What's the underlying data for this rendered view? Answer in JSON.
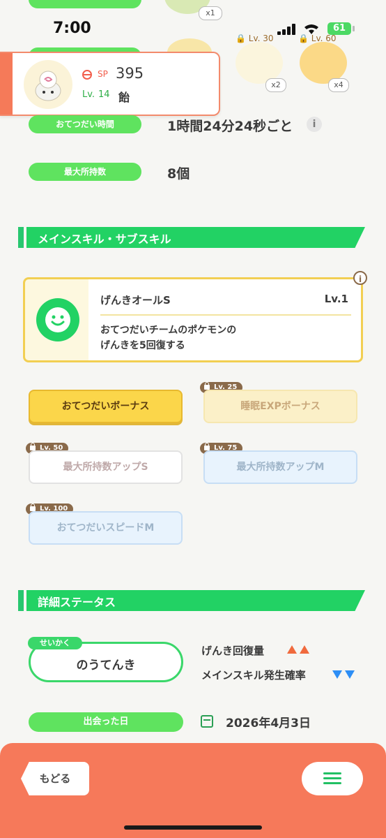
{
  "status_bar": {
    "time": "7:00",
    "battery": "61"
  },
  "top_items": {
    "count_1": "x1",
    "item_lv_30": "Lv. 30",
    "item_lv_60": "Lv. 60",
    "count_2": "x2",
    "count_4": "x4"
  },
  "pokemon": {
    "sp_label": "SP",
    "sp_value": "395",
    "lv_label": "Lv.",
    "lv_value": "14",
    "name": "飴"
  },
  "stats": {
    "help_time_label": "おてつだい時間",
    "help_time_value": "1時間24分24秒ごと",
    "max_carry_label": "最大所持数",
    "max_carry_value": "8個",
    "info_symbol": "i"
  },
  "skills_section": {
    "title": "メインスキル・サブスキル",
    "main_skill": {
      "name": "げんきオールS",
      "level": "Lv.1",
      "description": "おてつだいチームのポケモンの\nげんきを5回復する"
    },
    "sub_skills": [
      {
        "label": "おてつだいボーナス",
        "lock": ""
      },
      {
        "label": "睡眠EXPボーナス",
        "lock": "Lv. 25"
      },
      {
        "label": "最大所持数アップS",
        "lock": "Lv. 50"
      },
      {
        "label": "最大所持数アップM",
        "lock": "Lv. 75"
      },
      {
        "label": "おてつだいスピードM",
        "lock": "Lv. 100"
      }
    ]
  },
  "details_section": {
    "title": "詳細ステータス",
    "nature_tag": "せいかく",
    "nature_name": "のうてんき",
    "effect_up": "げんき回復量",
    "effect_down": "メインスキル発生確率",
    "met_label": "出会った日",
    "met_date": "2026年4月3日"
  },
  "bottom_bar": {
    "back_label": "もどる"
  },
  "colors": {
    "accent_green": "#22d264",
    "bottom_orange": "#f6795a",
    "skill_gold": "#f2cf52"
  }
}
